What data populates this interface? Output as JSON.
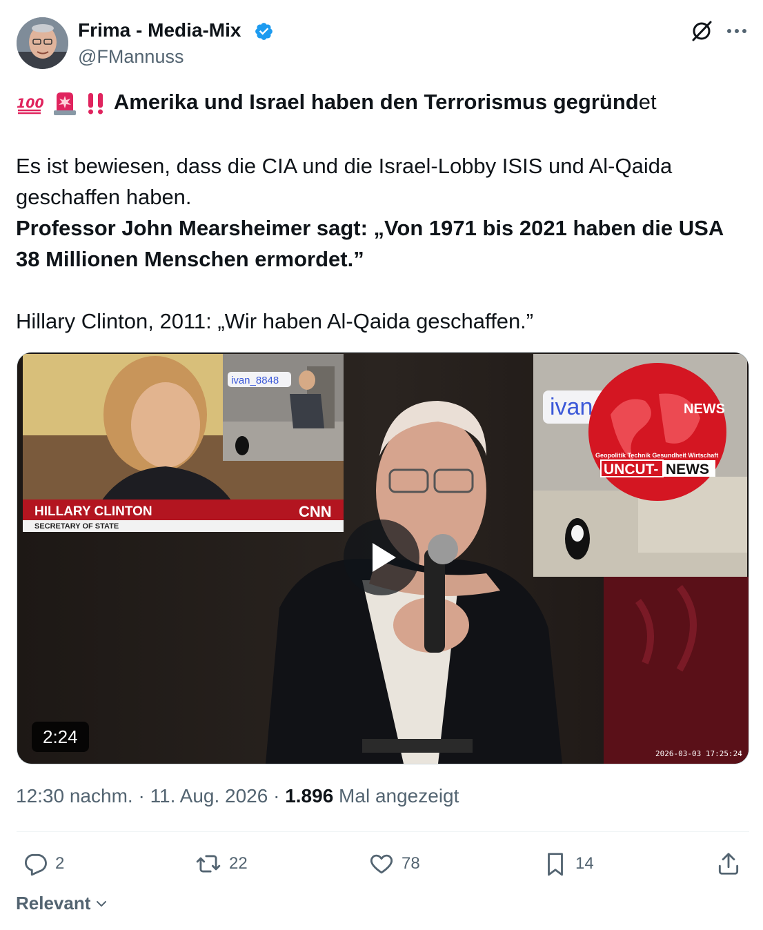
{
  "author": {
    "name": "Frima - Media-Mix",
    "handle": "@FMannuss"
  },
  "tweet": {
    "headline_bold": "Amerika und Israel haben den Terrorismus gegründ",
    "headline_tail": "et",
    "paragraph1": "Es ist bewiesen, dass die CIA und die Israel-Lobby ISIS und Al-Qaida geschaffen haben.",
    "paragraph2": "Professor John Mearsheimer sagt: „Von 1971 bis 2021 haben die USA 38 Millionen Menschen ermordet.”",
    "paragraph3": "Hillary Clinton, 2011: „Wir haben Al-Qaida geschaffen.”"
  },
  "video": {
    "duration": "2:24",
    "tag_ivan": "ivan_8848",
    "tag_ivan_large": "ivan",
    "lower_third_name": "HILLARY CLINTON",
    "lower_third_title": "SECRETARY OF STATE",
    "network": "CNN",
    "news_badge": "NEWS",
    "logo_tagline": "Geopolitik Technik Gesundheit Wirtschaft",
    "logo_uncut": "UNCUT-",
    "logo_news": "NEWS",
    "timestamp": "2026-03-03 17:25:24"
  },
  "meta": {
    "time": "12:30 nachm.",
    "sep1": " · ",
    "date": "11. Aug. 2026",
    "sep2": " · ",
    "views": "1.896",
    "views_label": " Mal angezeigt"
  },
  "actions": {
    "replies": "2",
    "reposts": "22",
    "likes": "78",
    "bookmarks": "14"
  },
  "sort": {
    "label": "Relevant"
  },
  "colors": {
    "verified": "#1d9bf0",
    "secondary_text": "#536471",
    "primary_text": "#0f1419"
  }
}
